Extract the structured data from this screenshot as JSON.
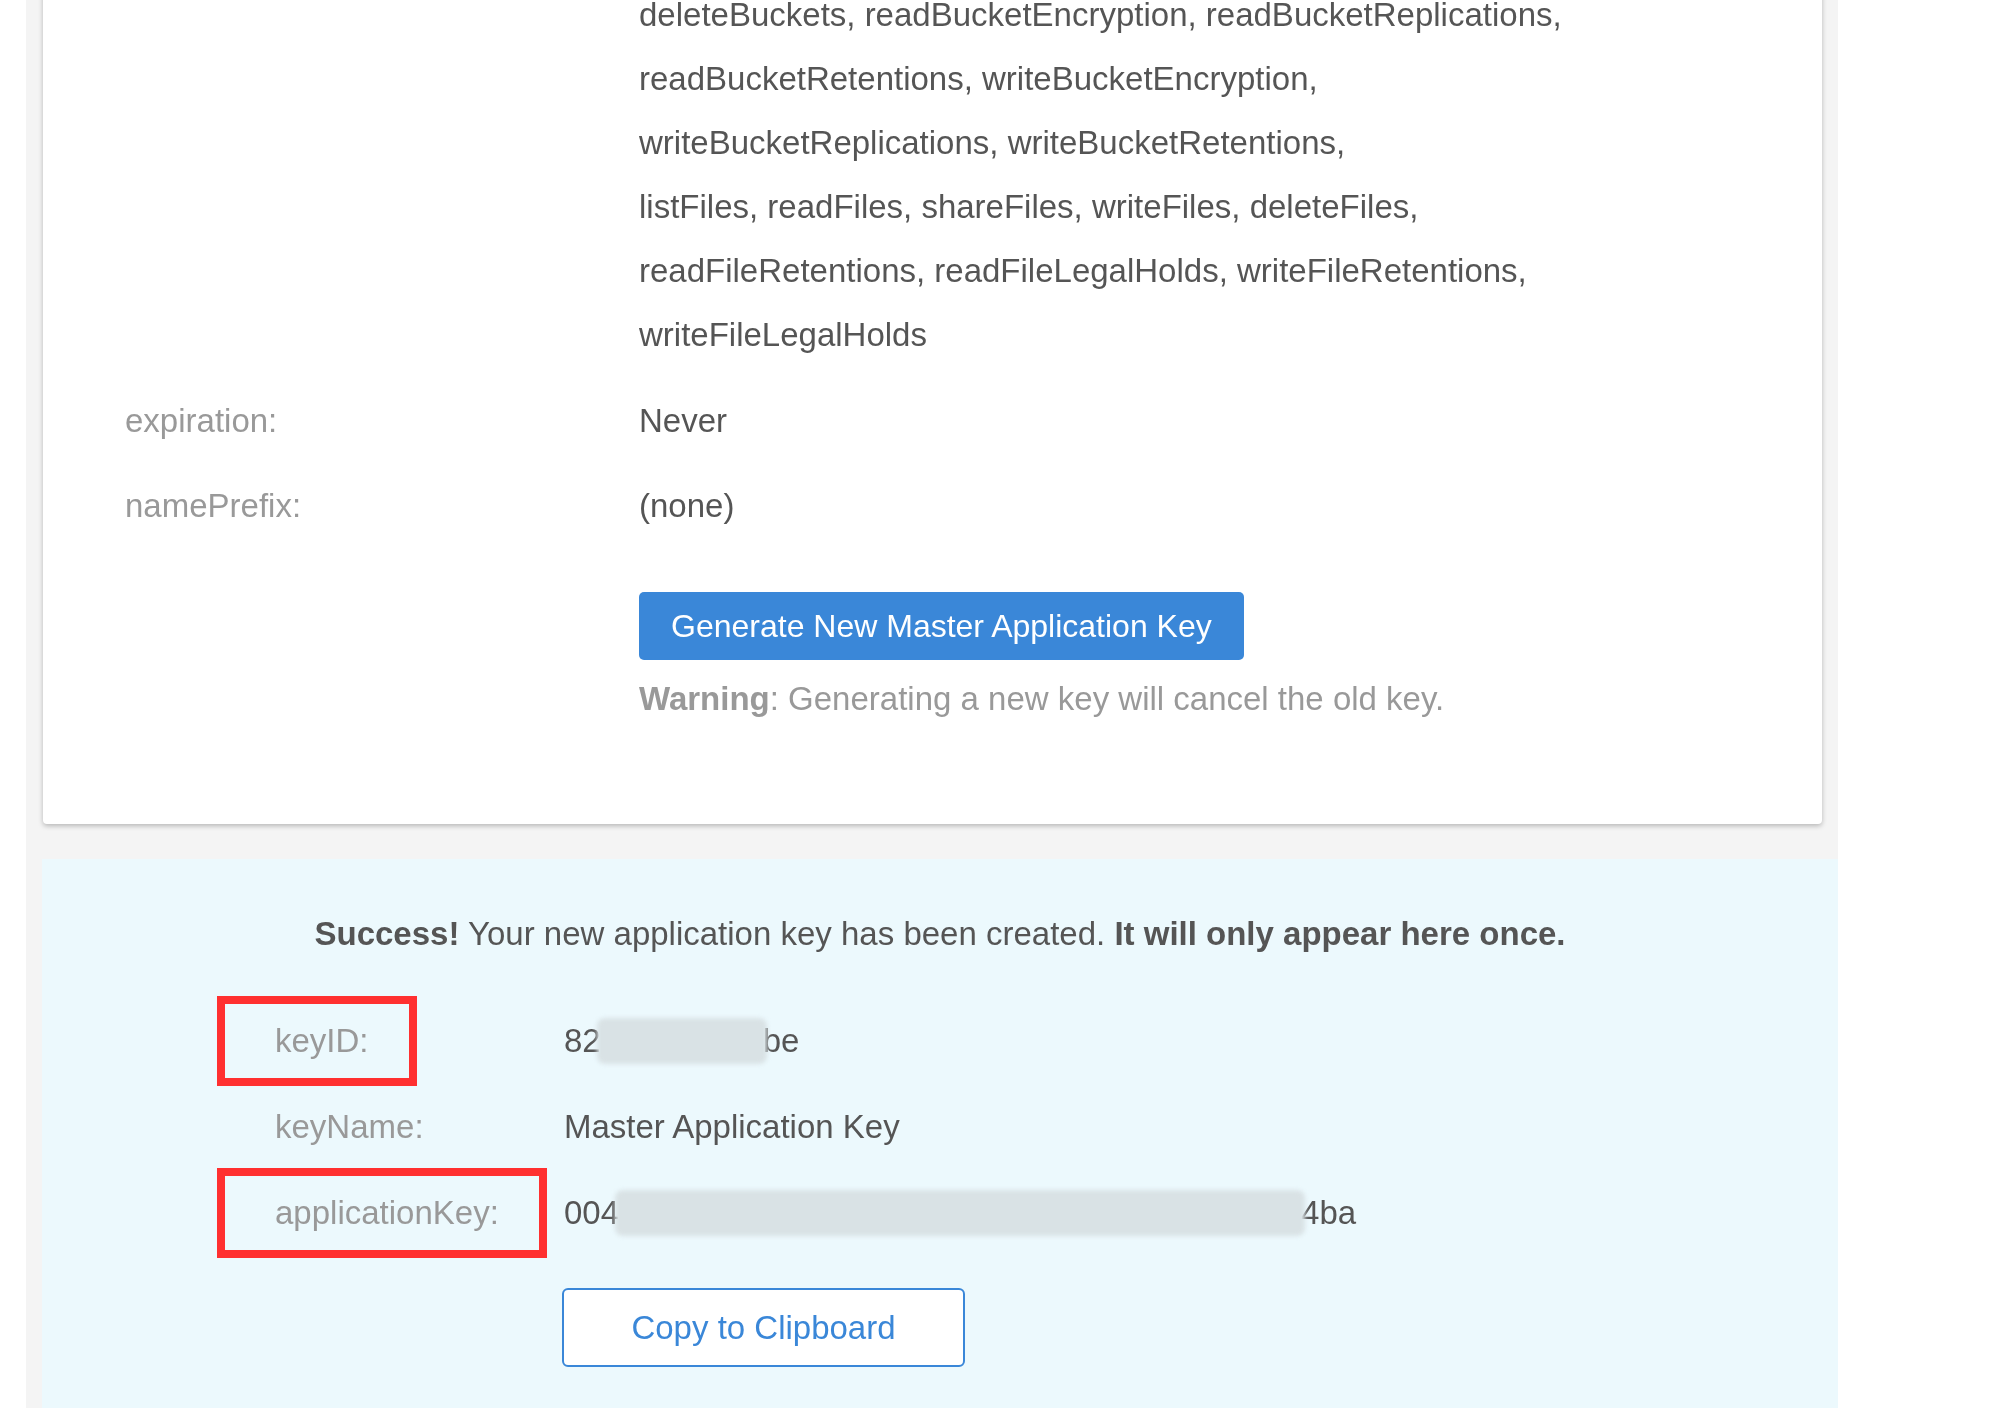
{
  "key_card": {
    "capabilities_lines": [
      "deleteBuckets, readBucketEncryption, readBucketReplications,",
      "readBucketRetentions, writeBucketEncryption,",
      "writeBucketReplications, writeBucketRetentions,",
      "listFiles, readFiles, shareFiles, writeFiles, deleteFiles,",
      "readFileRetentions, readFileLegalHolds, writeFileRetentions,",
      "writeFileLegalHolds"
    ],
    "fields": [
      {
        "label": "expiration:",
        "value": "Never"
      },
      {
        "label": "namePrefix:",
        "value": "(none)"
      }
    ],
    "button": "Generate New Master Application Key",
    "warning": "**Warning**: Generating a new key will cancel the old key."
  },
  "success_panel": {
    "message": "**Success!** Your new application key has been created. **It will only appear here once.**",
    "fields": [
      {
        "label": "keyID:",
        "kind": "redacted",
        "start": "82",
        "end": "be",
        "highlighted": true
      },
      {
        "label": "keyName:",
        "kind": "plain",
        "value": "Master Application Key",
        "highlighted": false
      },
      {
        "label": "applicationKey:",
        "kind": "redacted",
        "start": "004",
        "end": "4ba",
        "highlighted": true
      }
    ],
    "button": "Copy to Clipboard"
  }
}
